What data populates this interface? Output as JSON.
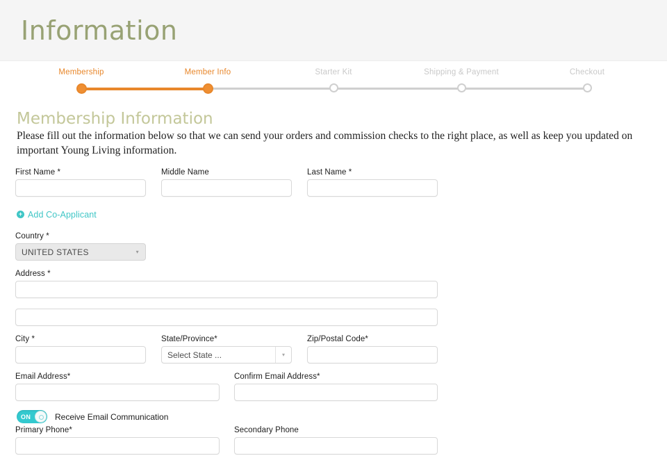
{
  "header": {
    "title": "Information"
  },
  "stepper": {
    "steps": [
      {
        "label": "Membership",
        "state": "done"
      },
      {
        "label": "Member Info",
        "state": "active"
      },
      {
        "label": "Starter Kit",
        "state": "todo"
      },
      {
        "label": "Shipping & Payment",
        "state": "todo"
      },
      {
        "label": "Checkout",
        "state": "todo"
      }
    ],
    "active_color": "#e8872b",
    "inactive_color": "#cfcfcf"
  },
  "section": {
    "title": "Membership Information",
    "description": "Please fill out the information below so that we can send your orders and commission checks to the right place, as well as keep you updated on important Young Living information."
  },
  "form": {
    "first_name": {
      "label": "First Name *",
      "value": "",
      "placeholder": ""
    },
    "middle_name": {
      "label": "Middle Name",
      "value": "",
      "placeholder": ""
    },
    "last_name": {
      "label": "Last Name *",
      "value": "",
      "placeholder": ""
    },
    "add_co_applicant": {
      "label": "Add Co-Applicant",
      "icon": "plus-circle-icon",
      "color": "#3fc6c6"
    },
    "country": {
      "label": "Country *",
      "value": "UNITED STATES",
      "caret": "▾"
    },
    "address": {
      "label": "Address *",
      "line1": "",
      "line2": "",
      "placeholder": ""
    },
    "city": {
      "label": "City *",
      "value": "",
      "placeholder": ""
    },
    "state": {
      "label": "State/Province*",
      "value": "Select State ...",
      "caret": "▾"
    },
    "zip": {
      "label": "Zip/Postal Code*",
      "value": "",
      "placeholder": ""
    },
    "email": {
      "label": "Email Address*",
      "value": "",
      "placeholder": ""
    },
    "confirm_email": {
      "label": "Confirm Email Address*",
      "value": "",
      "placeholder": ""
    },
    "email_toggle": {
      "state_text": "ON",
      "caption": "Receive Email Communication",
      "on_color": "#33c9cf"
    },
    "primary_phone": {
      "label": "Primary Phone*",
      "value": "",
      "placeholder": ""
    },
    "secondary_phone": {
      "label": "Secondary Phone",
      "value": "",
      "placeholder": ""
    }
  }
}
